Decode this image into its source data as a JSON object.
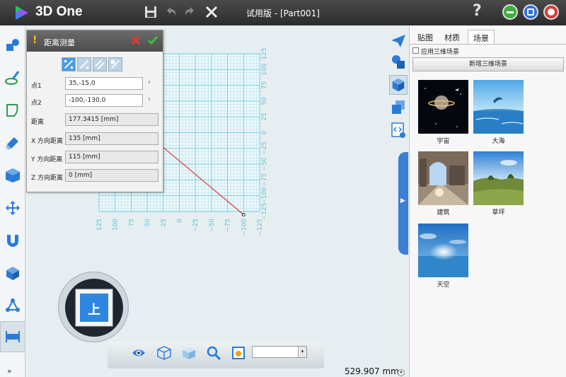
{
  "app": {
    "name": "3D One",
    "window_title": "试用版 - [Part001]"
  },
  "titlebar_icons": [
    "save-icon",
    "undo-icon",
    "redo-icon",
    "close-x-icon",
    "help-icon",
    "minimize-icon",
    "maximize-icon",
    "close-icon"
  ],
  "titlebar_help": "?",
  "left_toolbar": [
    "primitives-icon",
    "sketch-icon",
    "sketch-edit-icon",
    "feature-icon",
    "combine-icon",
    "transform-icon",
    "magnet-icon",
    "assembly-icon",
    "node-icon",
    "measure-icon"
  ],
  "left_toolbar_more": "»",
  "dialog": {
    "title": "距离测量",
    "warning_mark": "!",
    "mode_icons": [
      "point-point-icon",
      "point-line-icon",
      "line-line-icon",
      "point-plane-icon"
    ],
    "fields": [
      {
        "label": "点1",
        "value": "35,-15,0",
        "editable": true
      },
      {
        "label": "点2",
        "value": "-100,-130,0",
        "editable": true
      },
      {
        "label": "距离",
        "value": "177.3415  [mm]",
        "editable": false
      },
      {
        "label": "X 方向距离",
        "value": "135  [mm]",
        "editable": false
      },
      {
        "label": "Y 方向距离",
        "value": "115  [mm]",
        "editable": false
      },
      {
        "label": "Z 方向距离",
        "value": "0  [mm]",
        "editable": false
      }
    ],
    "field_arrow": "›"
  },
  "grid": {
    "x_ticks": [
      "125",
      "100",
      "75",
      "50",
      "25",
      "0",
      "−25",
      "−50",
      "−75",
      "−100",
      "−125"
    ],
    "y_ticks": [
      "125",
      "100",
      "75",
      "50",
      "25",
      "0",
      "−25",
      "−50",
      "−75",
      "−100",
      "−125"
    ],
    "measure_line": {
      "p1": [
        35,
        -15
      ],
      "p2": [
        -100,
        -130
      ],
      "color": "#d9534f"
    },
    "grid_color": "#5fc3d8"
  },
  "navcube": {
    "face_label": "上"
  },
  "bottom_bar": {
    "icons": [
      "eye-icon",
      "wireframe-cube-icon",
      "shaded-cube-icon",
      "zoom-icon",
      "render-icon"
    ],
    "select_value": "",
    "select_arrow": "▾"
  },
  "measure_readout": "529.907 mm",
  "measure_drop": "▾",
  "right_strip": [
    "paper-plane-icon",
    "shapes-icon",
    "cube-stack-icon",
    "cube-view-icon",
    "code-icon"
  ],
  "panel_toggle_arrow": "▶",
  "right_panel": {
    "tabs": [
      {
        "label": "贴图",
        "active": false
      },
      {
        "label": "材质",
        "active": false
      },
      {
        "label": "场景",
        "active": true
      }
    ],
    "apply_label": "应用三维场景",
    "new_scene_label": "新增三维场景",
    "scenes": [
      "宇宙",
      "大海",
      "建筑",
      "草坪",
      "天空"
    ]
  },
  "colors": {
    "accent": "#3a7fd4",
    "titlebar": "#3a3a3a",
    "grid": "#5fc3d8"
  }
}
